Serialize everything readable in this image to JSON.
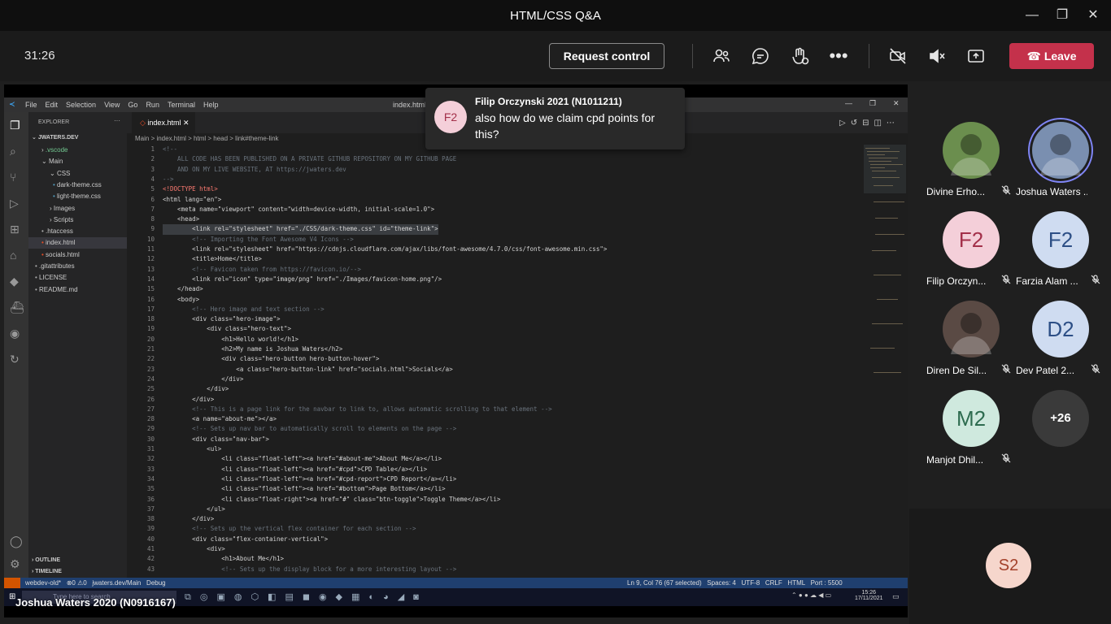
{
  "window": {
    "title": "HTML/CSS Q&A"
  },
  "toolbar": {
    "timer": "31:26",
    "request_control": "Request control",
    "leave": "Leave",
    "icons": [
      "people-icon",
      "chat-icon",
      "reactions-icon",
      "more-icon",
      "camera-off-icon",
      "mic-off-icon",
      "share-icon"
    ]
  },
  "notification": {
    "avatar": "F2",
    "sender": "Filip Orczynski 2021 (N1011211)",
    "message": "also how do we claim cpd points for this?"
  },
  "participants": [
    {
      "name": "Divine Erho...",
      "initials": "",
      "muted": true,
      "photo": true,
      "bg": "#6b8e4e"
    },
    {
      "name": "Joshua Waters ...",
      "initials": "",
      "muted": false,
      "photo": true,
      "bg": "#7a8fb0",
      "speaking": true
    },
    {
      "name": "Filip Orczyn...",
      "initials": "F2",
      "muted": true,
      "bg": "#f4cfd9",
      "fg": "#a3304a"
    },
    {
      "name": "Farzia Alam ...",
      "initials": "F2",
      "muted": true,
      "bg": "#cfdcf1",
      "fg": "#2d4f86"
    },
    {
      "name": "Diren De Sil...",
      "initials": "",
      "muted": true,
      "photo": true,
      "bg": "#5a4a44"
    },
    {
      "name": "Dev Patel 2...",
      "initials": "D2",
      "muted": true,
      "bg": "#cfdcf1",
      "fg": "#2d4f86"
    },
    {
      "name": "Manjot Dhil...",
      "initials": "M2",
      "muted": true,
      "bg": "#cfe9de",
      "fg": "#2d6b4f"
    },
    {
      "name": "",
      "initials": "+26",
      "muted": false,
      "bg": "#3a3a3a",
      "fg": "#ffffff"
    }
  ],
  "self_tile": {
    "initials": "S2"
  },
  "presenter": "Joshua Waters 2020 (N0916167)",
  "vscode": {
    "menu": [
      "File",
      "Edit",
      "Selection",
      "View",
      "Go",
      "Run",
      "Terminal",
      "Help"
    ],
    "window_title": "index.html -",
    "explorer_title": "EXPLORER",
    "root": "JWATERS.DEV",
    "tree": [
      ".vscode",
      "Main",
      "CSS",
      "dark-theme.css",
      "light-theme.css",
      "Images",
      "Scripts",
      ".htaccess",
      "index.html",
      "socials.html",
      ".gitattributes",
      "LICENSE",
      "README.md"
    ],
    "tab": "index.html",
    "breadcrumb": "Main > index.html > html > head > link#theme-link",
    "outline": "OUTLINE",
    "timeline": "TIMELINE",
    "status_left": "webdev-old*   ⊗0 ⚠0   jwaters.dev/Main   Debug",
    "status_right": "Ln 9, Col 76 (67 selected)   Spaces: 4   UTF-8   CRLF   HTML   Port : 5500",
    "search_placeholder": "Type here to search",
    "clock_time": "15:26",
    "clock_date": "17/11/2021",
    "lines": [
      "<!--",
      "    ALL CODE HAS BEEN PUBLISHED ON A PRIVATE GITHUB REPOSITORY ON MY GITHUB PAGE",
      "    AND ON MY LIVE WEBSITE, AT https://jwaters.dev",
      "-->",
      "<!DOCTYPE html>",
      "<html lang=\"en\">",
      "    <meta name=\"viewport\" content=\"width=device-width, initial-scale=1.0\">",
      "    <head>",
      "        <link rel=\"stylesheet\" href=\"./CSS/dark-theme.css\" id=\"theme-link\">",
      "        <!-- Importing the Font Awesome V4 Icons -->",
      "        <link rel=\"stylesheet\" href=\"https://cdnjs.cloudflare.com/ajax/libs/font-awesome/4.7.0/css/font-awesome.min.css\">",
      "        <title>Home</title>",
      "        <!-- Favicon taken from https://favicon.io/-->",
      "        <link rel=\"icon\" type=\"image/png\" href=\"./Images/favicon-home.png\"/>",
      "    </head>",
      "    <body>",
      "        <!-- Hero image and text section -->",
      "        <div class=\"hero-image\">",
      "            <div class=\"hero-text\">",
      "                <h1>Hello world!</h1>",
      "                <h2>My name is Joshua Waters</h2>",
      "                <div class=\"hero-button hero-button-hover\">",
      "                    <a class=\"hero-button-link\" href=\"socials.html\">Socials</a>",
      "                </div>",
      "            </div>",
      "        </div>",
      "        <!-- This is a page link for the navbar to link to, allows automatic scrolling to that element -->",
      "        <a name=\"about-me\"></a>",
      "        <!-- Sets up nav bar to automatically scroll to elements on the page -->",
      "        <div class=\"nav-bar\">",
      "            <ul>",
      "                <li class=\"float-left\"><a href=\"#about-me\">About Me</a></li>",
      "                <li class=\"float-left\"><a href=\"#cpd\">CPD Table</a></li>",
      "                <li class=\"float-left\"><a href=\"#cpd-report\">CPD Report</a></li>",
      "                <li class=\"float-left\"><a href=\"#bottom\">Page Bottom</a></li>",
      "                <li class=\"float-right\"><a href=\"#\" class=\"btn-toggle\">Toggle Theme</a></li>",
      "            </ul>",
      "        </div>",
      "        <!-- Sets up the vertical flex container for each section -->",
      "        <div class=\"flex-container-vertical\">",
      "            <div>",
      "                <h1>About Me</h1>",
      "                <!-- Sets up the display block for a more interesting layout -->"
    ]
  }
}
